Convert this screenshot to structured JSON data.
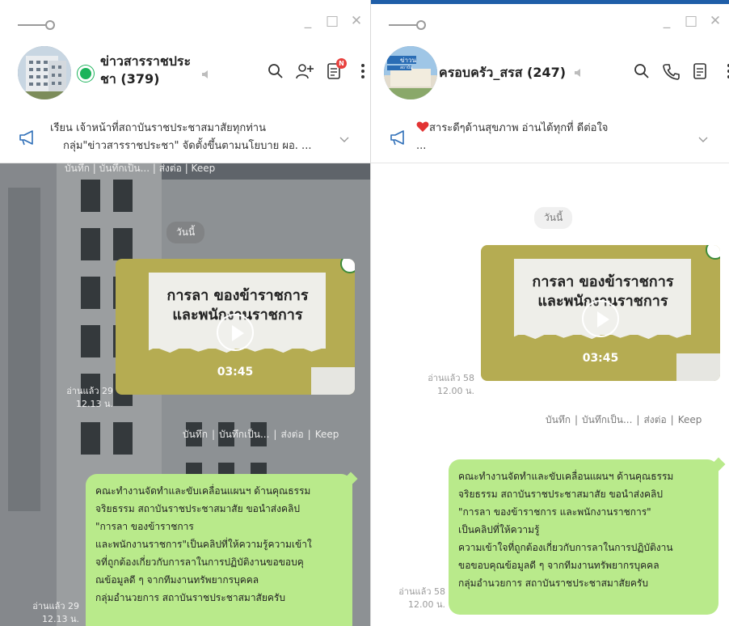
{
  "colors": {
    "bubble": "#b9ea8b",
    "online": "#1bb35a",
    "accent_line": "#1f5ea8",
    "video_bg": "#b5ac52",
    "badge": "#e8413e"
  },
  "icons": {
    "title_left": "slider-icon",
    "window": [
      "minimize-icon",
      "maximize-icon",
      "close-icon"
    ],
    "header": [
      "search-icon",
      "add-friend-icon",
      "notes-icon",
      "more-icon",
      "phone-icon"
    ],
    "announce": [
      "megaphone-icon",
      "chevron-down-icon"
    ],
    "video": "play-icon"
  },
  "window_controls": {
    "minimize": "_",
    "maximize": "□",
    "close": "✕"
  },
  "left": {
    "chat_name_line1": "ข่าวสารราชประ",
    "chat_name_line2": "ชา (379)",
    "notes_badge": "N",
    "announcement_line1": "เรียน  เจ้าหน้าที่สถาบันราชประชาสมาสัยทุกท่าน",
    "announcement_line2": "กลุ่ม\"ข่าวสารราชประชา\" จัดตั้งขึ้นตามนโยบาย ผอ. ...",
    "top_actions": "บันทึก | บันทึกเป็น... | ส่งต่อ | Keep",
    "date": "วันนี้",
    "video_title_line1": "การลา ของข้าราชการ",
    "video_title_line2": "และพนักงานราชการ",
    "video_duration": "03:45",
    "video_read": "อ่านแล้ว 29",
    "video_time": "12.13 น.",
    "actions": {
      "save": "บันทึก",
      "save_as": "บันทึกเป็น...",
      "forward": "ส่งต่อ",
      "keep": "Keep"
    },
    "message_lines": [
      "คณะทำงานจัดทำและขับเคลื่อนแผนฯ ด้านคุณธรรม",
      "จริยธรรม  สถาบันราชประชาสมาสัย ขอนำส่งคลิป",
      "\"การลา ของข้าราชการ",
      "และพนักงานราชการ\"เป็นคลิปที่ให้ความรู้ความเข้าใ",
      "จที่ถูกต้องเกี่ยวกับการลาในการปฏิบัติงานขอขอบคุ",
      "ณข้อมูลดี ๆ จากทีมงานทรัพยากรบุคคล",
      "กลุ่มอำนวยการ  สถาบันราชประชาสมาสัยครับ"
    ],
    "message_read": "อ่านแล้ว 29",
    "message_time": "12.13 น."
  },
  "right": {
    "chat_name": "ครอบครัว_สรส (247)",
    "avatar_caption_1": "ข่าวน",
    "avatar_caption_2": "สถาบัน",
    "announcement_line1": "สาระดีๆด้านสุขภาพ อ่านได้ทุกที่ ดีต่อใจ",
    "announcement_line2": "...",
    "date": "วันนี้",
    "video_title_line1": "การลา ของข้าราชการ",
    "video_title_line2": "และพนักงานราชการ",
    "video_duration": "03:45",
    "video_read": "อ่านแล้ว 58",
    "video_time": "12.00 น.",
    "actions": {
      "save": "บันทึก",
      "save_as": "บันทึกเป็น...",
      "forward": "ส่งต่อ",
      "keep": "Keep"
    },
    "message_lines": [
      "คณะทำงานจัดทำและขับเคลื่อนแผนฯ ด้านคุณธรรม",
      "จริยธรรม  สถาบันราชประชาสมาสัย ขอนำส่งคลิป",
      "\"การลา ของข้าราชการ และพนักงานราชการ\"",
      "เป็นคลิปที่ให้ความรู้",
      "ความเข้าใจที่ถูกต้องเกี่ยวกับการลาในการปฏิบัติงาน",
      "ขอขอบคุณข้อมูลดี ๆ  จากทีมงานทรัพยากรบุคคล",
      "กลุ่มอำนวยการ  สถาบันราชประชาสมาสัยครับ"
    ],
    "message_read": "อ่านแล้ว 58",
    "message_time": "12.00 น."
  }
}
